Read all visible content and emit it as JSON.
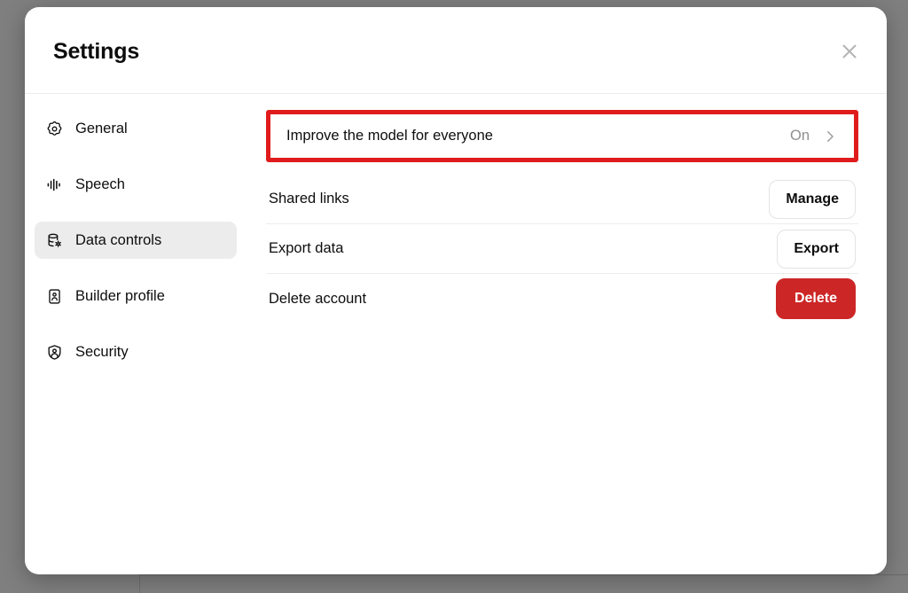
{
  "modal": {
    "title": "Settings",
    "close_icon": "close-icon"
  },
  "sidebar": {
    "items": [
      {
        "label": "General",
        "icon": "gear-icon",
        "active": false
      },
      {
        "label": "Speech",
        "icon": "waveform-icon",
        "active": false
      },
      {
        "label": "Data controls",
        "icon": "database-gear-icon",
        "active": true
      },
      {
        "label": "Builder profile",
        "icon": "id-card-icon",
        "active": false
      },
      {
        "label": "Security",
        "icon": "shield-person-icon",
        "active": false
      }
    ]
  },
  "content": {
    "rows": [
      {
        "label": "Improve the model for everyone",
        "value": "On",
        "control": "chevron",
        "highlighted": true
      },
      {
        "label": "Shared links",
        "button_label": "Manage",
        "control": "button-outline",
        "highlighted": false
      },
      {
        "label": "Export data",
        "button_label": "Export",
        "control": "button-outline",
        "highlighted": false
      },
      {
        "label": "Delete account",
        "button_label": "Delete",
        "control": "button-danger",
        "highlighted": false
      }
    ]
  },
  "colors": {
    "annotation_red": "#e01b1b",
    "danger_red": "#cc2626",
    "active_item_bg": "#ececec",
    "divider": "#ececec",
    "muted_text": "#8f8f8f",
    "overlay": "#7f7f7f"
  }
}
